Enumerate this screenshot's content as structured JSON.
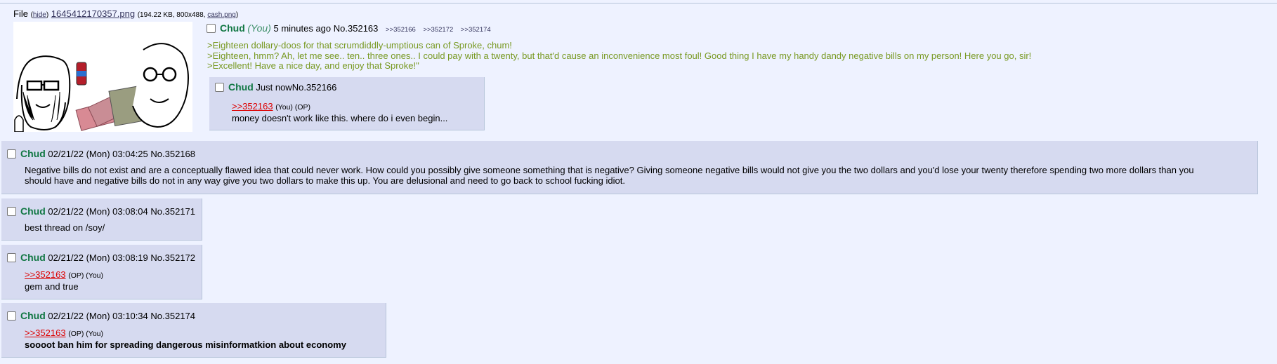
{
  "op": {
    "file_label": "File",
    "hide_label": "hide",
    "filename": "1645412170357.png",
    "file_meta": "(194.22 KB, 800x488,",
    "original_name": "cash.png",
    "file_meta_close": ")",
    "name": "Chud",
    "you_tag": "(You)",
    "time": "5 minutes ago",
    "post_no": "No.352163",
    "backlinks": [
      ">>352166",
      ">>352172",
      ">>352174"
    ],
    "lines": [
      ">Eighteen dollary-doos for that scrumdiddly-umptious can of Sproke, chum!",
      ">Eighteen, hmm? Ah, let me see.. ten.. three ones.. I could pay with a twenty, but that'd cause an inconvenience most foul! Good thing I have my handy dandy negative bills on my person! Here you go, sir!",
      ">Excellent! Have a nice day, and enjoy that Sproke!\""
    ]
  },
  "replies": [
    {
      "name": "Chud",
      "time": "Just now",
      "post_no": "No.352166",
      "quote": ">>352163",
      "tags": "(You) (OP)",
      "text": "money doesn't work like this. where do i even begin..."
    },
    {
      "name": "Chud",
      "time": "02/21/22 (Mon) 03:04:25",
      "post_no": "No.352168",
      "lines": [
        "Negative bills do not exist and are a conceptually flawed idea that could never work. How could you possibly give someone something that is negative? Giving someone negative bills would not give you the two dollars and you'd lose your twenty therefore spending two more dollars than you",
        "should have and negative bills do not in any way give you two dollars to make this up. You are delusional and need to go back to school fucking idiot."
      ]
    },
    {
      "name": "Chud",
      "time": "02/21/22 (Mon) 03:08:04",
      "post_no": "No.352171",
      "text": "best thread on /soy/"
    },
    {
      "name": "Chud",
      "time": "02/21/22 (Mon) 03:08:19",
      "post_no": "No.352172",
      "quote": ">>352163",
      "tags": "(OP) (You)",
      "text": "gem and true"
    },
    {
      "name": "Chud",
      "time": "02/21/22 (Mon) 03:10:34",
      "post_no": "No.352174",
      "quote": ">>352163",
      "tags": "(OP) (You)",
      "text": "soooot ban him for spreading dangerous misinformatkion about economy"
    }
  ]
}
